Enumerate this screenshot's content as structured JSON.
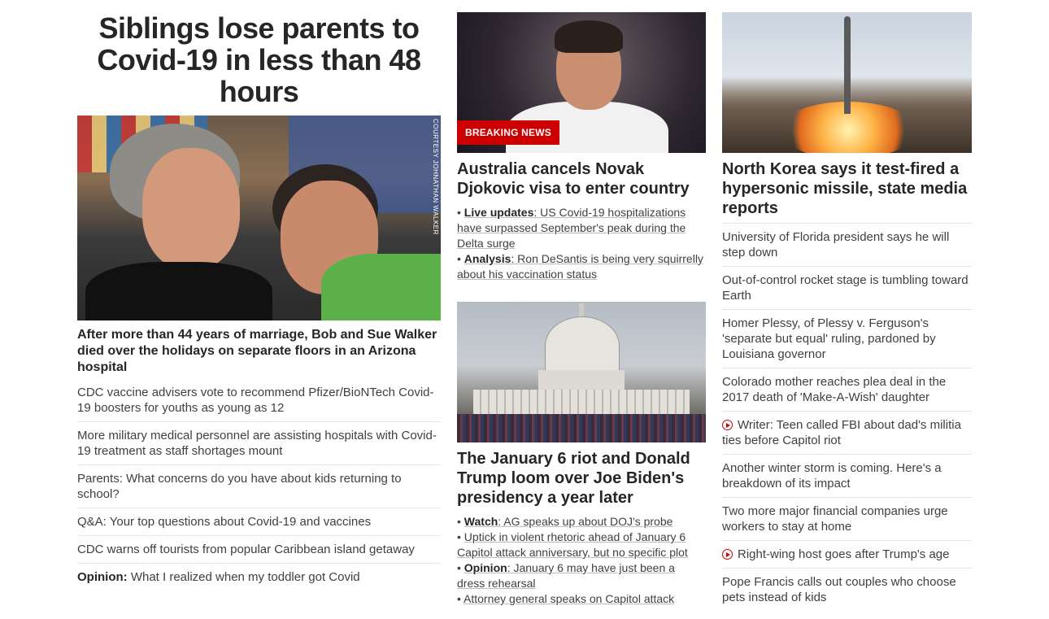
{
  "col1": {
    "headline": "Siblings lose parents to Covid-19 in less than 48 hours",
    "photo_credit": "COURTESY JOHNATHAN WALKER",
    "subhead": "After more than 44 years of marriage, Bob and Sue Walker died over the holidays on separate floors in an Arizona hospital",
    "links": [
      {
        "prefix": "",
        "text": "CDC vaccine advisers vote to recommend Pfizer/BioNTech Covid-19 boosters for youths as young as 12"
      },
      {
        "prefix": "",
        "text": "More military medical personnel are assisting hospitals with Covid-19 treatment as staff shortages mount"
      },
      {
        "prefix": "",
        "text": "Parents: What concerns do you have about kids returning to school?"
      },
      {
        "prefix": "",
        "text": "Q&A: Your top questions about Covid-19 and vaccines"
      },
      {
        "prefix": "",
        "text": "CDC warns off tourists from popular Caribbean island getaway"
      },
      {
        "prefix": "Opinion:",
        "text": " What I realized when my toddler got Covid"
      }
    ]
  },
  "col2": {
    "story1": {
      "badge": "BREAKING NEWS",
      "title": "Australia cancels Novak Djokovic visa to enter country",
      "bullets": [
        {
          "label": "Live updates",
          "text": ": US Covid-19 hospitalizations have surpassed September's peak during the Delta surge"
        },
        {
          "label": "Analysis",
          "text": ": Ron DeSantis is being very squirrelly about his vaccination status"
        }
      ]
    },
    "story2": {
      "title": "The January 6 riot and Donald Trump loom over Joe Biden's presidency a year later",
      "bullets": [
        {
          "label": "Watch",
          "text": ": AG speaks up about DOJ's probe"
        },
        {
          "label": "",
          "text": "Uptick in violent rhetoric ahead of January 6 Capitol attack anniversary, but no specific plot"
        },
        {
          "label": "Opinion",
          "text": ": January 6 may have just been a dress rehearsal"
        },
        {
          "label": "",
          "text": "Attorney general speaks on Capitol attack"
        }
      ]
    }
  },
  "col3": {
    "title": "North Korea says it test-fired a hypersonic missile, state media reports",
    "links": [
      {
        "video": false,
        "text": "University of Florida president says he will step down"
      },
      {
        "video": false,
        "text": "Out-of-control rocket stage is tumbling toward Earth"
      },
      {
        "video": false,
        "text": "Homer Plessy, of Plessy v. Ferguson's 'separate but equal' ruling, pardoned by Louisiana governor"
      },
      {
        "video": false,
        "text": "Colorado mother reaches plea deal in the 2017 death of 'Make-A-Wish' daughter"
      },
      {
        "video": true,
        "text": "Writer: Teen called FBI about dad's militia ties before Capitol riot"
      },
      {
        "video": false,
        "text": "Another winter storm is coming. Here's a breakdown of its impact"
      },
      {
        "video": false,
        "text": "Two more major financial companies urge workers to stay at home"
      },
      {
        "video": true,
        "text": "Right-wing host goes after Trump's age"
      },
      {
        "video": false,
        "text": "Pope Francis calls out couples who choose pets instead of kids"
      }
    ]
  },
  "colors": {
    "accent": "#cc0000",
    "text": "#262626",
    "divider": "#e6e6e6"
  }
}
